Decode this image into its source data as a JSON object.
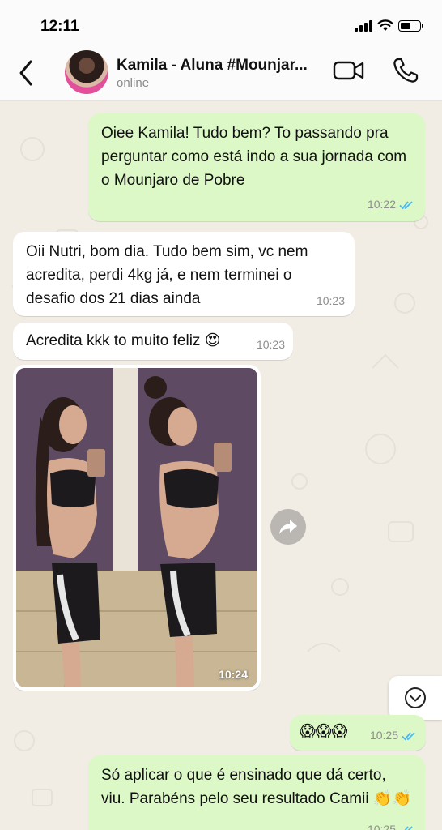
{
  "status_bar": {
    "time": "12:11",
    "signal_icon": "cellular-signal-icon",
    "wifi_icon": "wifi-icon",
    "battery_icon": "battery-icon",
    "battery_level": 0.55
  },
  "header": {
    "back_icon": "chevron-left-icon",
    "contact_name": "Kamila - Aluna #Mounjar...",
    "contact_status": "online",
    "video_icon": "video-camera-icon",
    "call_icon": "phone-icon"
  },
  "colors": {
    "outgoing_bubble": "#dcf8c6",
    "incoming_bubble": "#ffffff",
    "chat_background": "#f1ede5",
    "read_ticks": "#4fb6ec"
  },
  "messages": [
    {
      "direction": "outgoing",
      "text": "Oiee Kamila! Tudo bem? To passando pra perguntar como está indo a sua jornada com o Mounjaro de Pobre",
      "time": "10:22",
      "status": "read"
    },
    {
      "direction": "incoming",
      "text": "Oii Nutri, bom dia. Tudo bem sim, vc nem acredita, perdi 4kg já, e nem terminei o desafio dos 21 dias ainda",
      "time": "10:23"
    },
    {
      "direction": "incoming",
      "text": "Acredita kkk to muito feliz 😍",
      "time": "10:23"
    },
    {
      "direction": "incoming",
      "type": "image",
      "time": "10:24",
      "forward_icon": "forward-arrow-icon"
    },
    {
      "direction": "outgoing",
      "text": "😱😱😱",
      "time": "10:25",
      "status": "read"
    },
    {
      "direction": "outgoing",
      "text": "Só aplicar o que é ensinado que dá certo, viu. Parabéns pelo seu resultado Camii 👏👏",
      "time": "10:25",
      "status": "read"
    }
  ],
  "scroll_down_icon": "chevron-down-circle-icon"
}
